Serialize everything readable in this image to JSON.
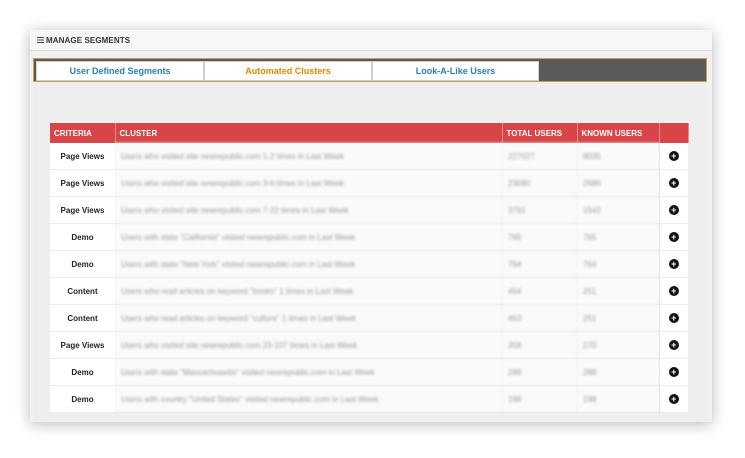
{
  "header": {
    "title": "MANAGE SEGMENTS",
    "menu_icon": "menu-icon"
  },
  "tabs": [
    {
      "label": "User Defined Segments"
    },
    {
      "label": "Automated Clusters"
    },
    {
      "label": "Look-A-Like Users"
    }
  ],
  "table": {
    "columns": [
      "CRITERIA",
      "CLUSTER",
      "TOTAL USERS",
      "KNOWN USERS",
      ""
    ],
    "rows": [
      {
        "criteria": "Page Views",
        "cluster": "Users who visited site newrepublic.com 1-2 times in Last Week",
        "total": "227027",
        "known": "8035"
      },
      {
        "criteria": "Page Views",
        "cluster": "Users who visited site newrepublic.com 3-6 times in Last Week",
        "total": "23080",
        "known": "2686"
      },
      {
        "criteria": "Page Views",
        "cluster": "Users who visited site newrepublic.com 7-22 times in Last Week",
        "total": "3791",
        "known": "1542"
      },
      {
        "criteria": "Demo",
        "cluster": "Users with state \"California\" visited newrepublic.com in Last Week",
        "total": "765",
        "known": "765"
      },
      {
        "criteria": "Demo",
        "cluster": "Users with state \"New York\" visited newrepublic.com in Last Week",
        "total": "764",
        "known": "764"
      },
      {
        "criteria": "Content",
        "cluster": "Users who read articles on keyword \"books\" 1 times in Last Week",
        "total": "454",
        "known": "251"
      },
      {
        "criteria": "Content",
        "cluster": "Users who read articles on keyword \"culture\" 1 times in Last Week",
        "total": "453",
        "known": "251"
      },
      {
        "criteria": "Page Views",
        "cluster": "Users who visited site newrepublic.com 23-107 times in Last Week",
        "total": "358",
        "known": "270"
      },
      {
        "criteria": "Demo",
        "cluster": "Users with state \"Massachusetts\" visited newrepublic.com in Last Week",
        "total": "288",
        "known": "288"
      },
      {
        "criteria": "Demo",
        "cluster": "Users with country \"United States\" visited newrepublic.com in Last Week",
        "total": "198",
        "known": "198"
      }
    ]
  },
  "colors": {
    "header_red": "#d84548",
    "active_tab": "#e08a00",
    "tab_blue": "#2a7fb8",
    "tabbar_bg": "#5a5a5a"
  }
}
